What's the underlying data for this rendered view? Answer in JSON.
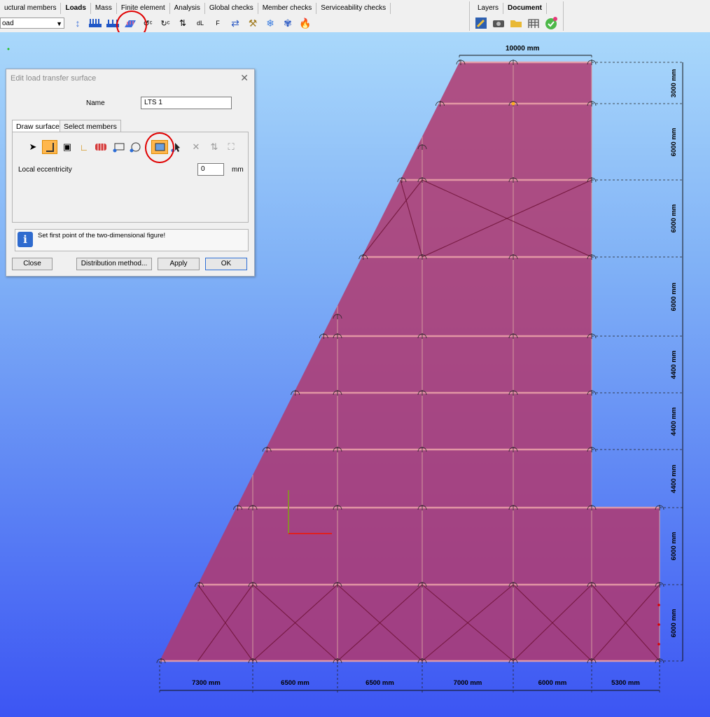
{
  "ribbon": {
    "tabs": [
      "uctural members",
      "Loads",
      "Mass",
      "Finite element",
      "Analysis",
      "Global checks",
      "Member checks",
      "Serviceability checks"
    ],
    "right_tabs": [
      "Layers",
      "Document"
    ],
    "active_tab": "Loads",
    "combo_value": "oad",
    "tool_icons": [
      "point-load-icon",
      "line-load-icon",
      "distributed-load-icon",
      "load-transfer-surface-icon",
      "temperature-load-icon",
      "temperature-gradient-icon",
      "support-displacement-icon",
      "dL-load-icon",
      "force-icon",
      "moving-load-icon",
      "crane-load-icon",
      "snow-load-icon",
      "wind-load-icon",
      "fire-icon"
    ],
    "dl_label": "dL",
    "f_label": "F",
    "doc_icons": [
      "edit-document-icon",
      "camera-icon",
      "folder-icon",
      "structure-icon",
      "status-icon"
    ]
  },
  "dialog": {
    "title": "Edit load transfer surface",
    "name_label": "Name",
    "name_value": "LTS 1",
    "tabs": [
      "Draw surface",
      "Select members"
    ],
    "eccentricity_label": "Local eccentricity",
    "eccentricity_value": "0",
    "eccentricity_unit": "mm",
    "info_text": "Set first point of the two-dimensional figure!",
    "buttons": {
      "close": "Close",
      "distribution": "Distribution method...",
      "apply": "Apply",
      "ok": "OK"
    }
  },
  "model": {
    "surface_color": "#b0386e",
    "top_dimension": "10000 mm",
    "bottom_dimensions": [
      "7300 mm",
      "6500 mm",
      "6500 mm",
      "7000 mm",
      "6000 mm",
      "5300 mm"
    ],
    "right_dimensions": [
      "3000 mm",
      "6000 mm",
      "6000 mm",
      "6000 mm",
      "4400 mm",
      "4400 mm",
      "4400 mm",
      "6000 mm",
      "6000 mm"
    ]
  }
}
